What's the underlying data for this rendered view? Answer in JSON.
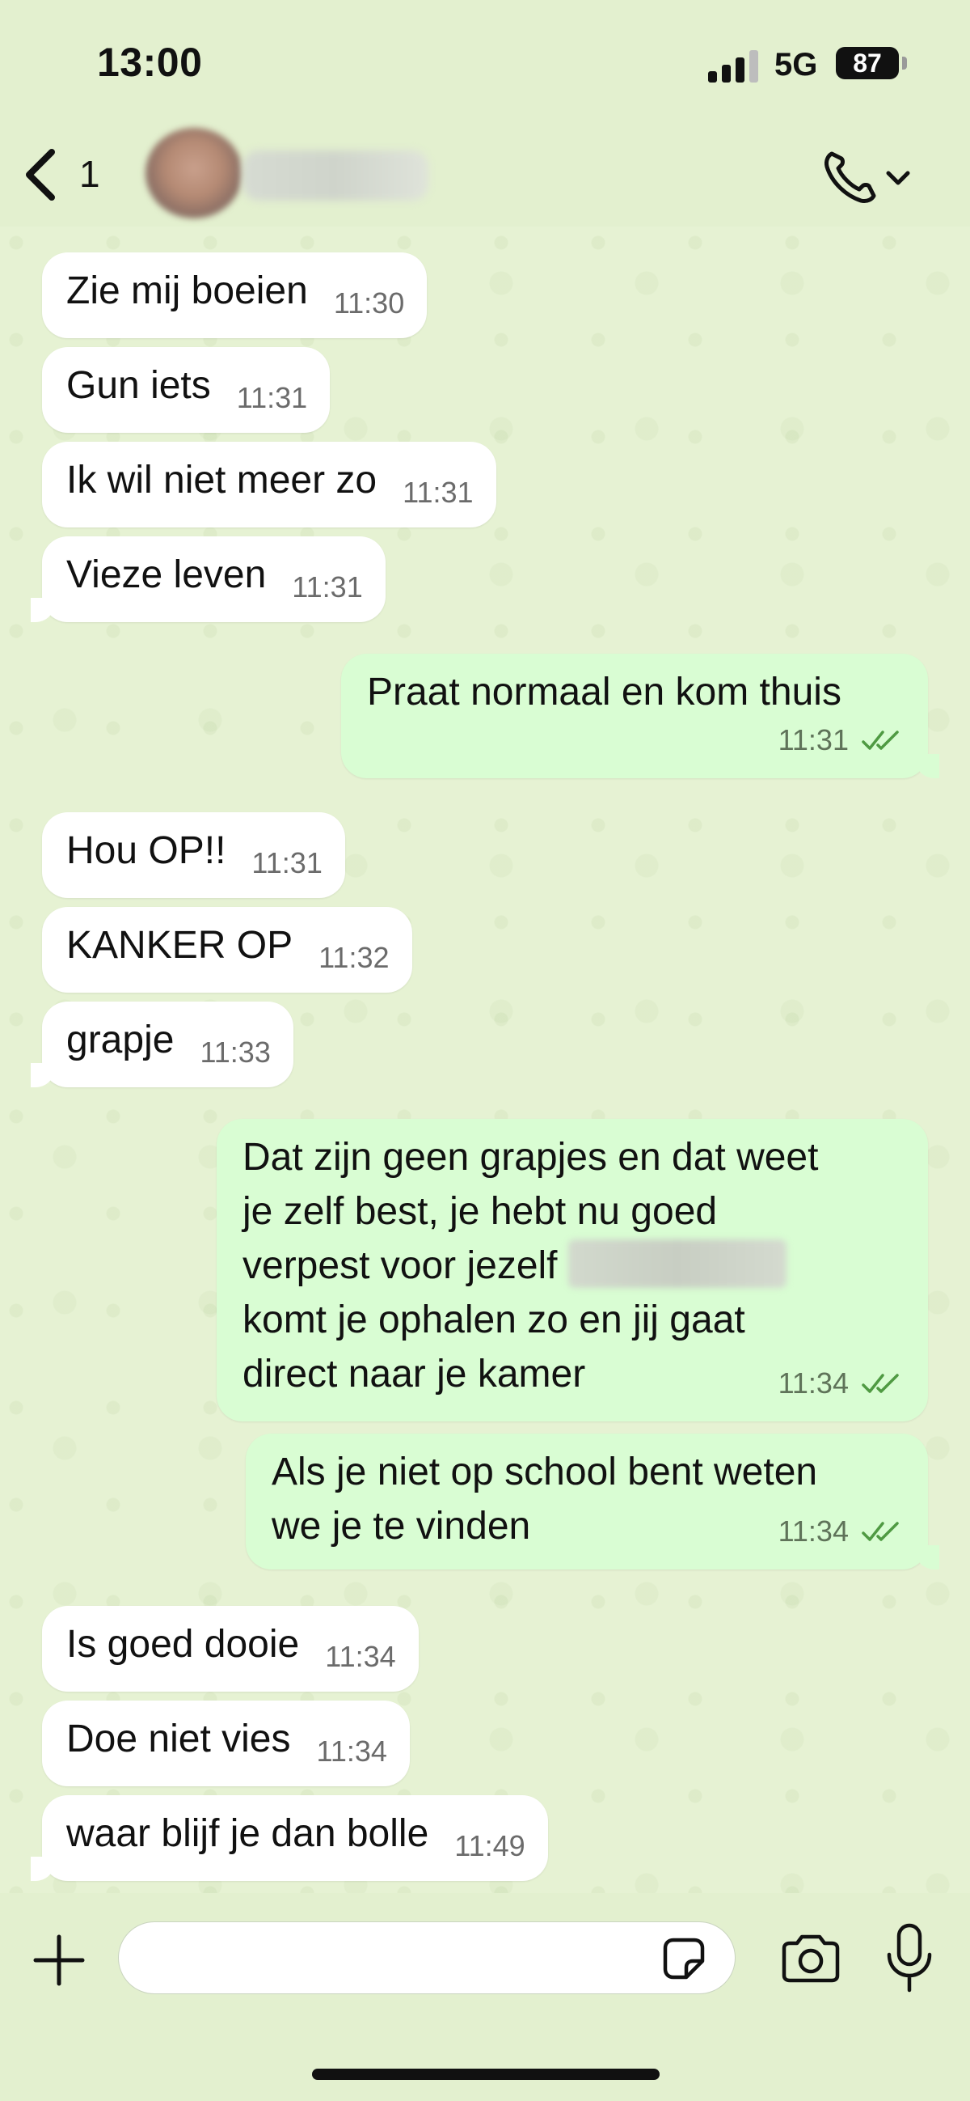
{
  "status_bar": {
    "time": "13:00",
    "network": "5G",
    "battery": "87",
    "signal_bars_active": 3,
    "signal_bars_total": 4
  },
  "header": {
    "back_count": "1",
    "back_icon": "chevron-left-icon",
    "call_icon": "phone-icon",
    "call_dropdown_icon": "chevron-down-icon"
  },
  "messages": [
    {
      "dir": "in",
      "text": "Zie mij boeien",
      "time": "11:30"
    },
    {
      "dir": "in",
      "text": "Gun iets",
      "time": "11:31"
    },
    {
      "dir": "in",
      "text": "Ik wil niet meer zo",
      "time": "11:31"
    },
    {
      "dir": "in",
      "text": "Vieze leven",
      "time": "11:31"
    },
    {
      "dir": "out",
      "text": "Praat normaal en kom thuis",
      "time": "11:31",
      "status": "read"
    },
    {
      "dir": "in",
      "text": "Hou OP!!",
      "time": "11:31"
    },
    {
      "dir": "in",
      "text": "KANKER OP",
      "time": "11:32"
    },
    {
      "dir": "in",
      "text": "grapje",
      "time": "11:33"
    },
    {
      "dir": "out",
      "line1": "Dat zijn geen grapjes en dat weet",
      "line2": "je zelf best, je hebt nu goed",
      "line3_start": "verpest voor jezelf",
      "line4": "komt je ophalen zo en jij gaat",
      "line5": "direct naar je kamer",
      "time": "11:34",
      "status": "read"
    },
    {
      "dir": "out",
      "line1": "Als je niet op school bent weten",
      "line2": "we je te vinden",
      "time": "11:34",
      "status": "read"
    },
    {
      "dir": "in",
      "text": "Is goed dooie",
      "time": "11:34"
    },
    {
      "dir": "in",
      "text": "Doe niet vies",
      "time": "11:34"
    },
    {
      "dir": "in",
      "text": "waar blijf je dan bolle",
      "time": "11:49"
    }
  ],
  "composer": {
    "placeholder": "",
    "value": "",
    "icons": [
      "plus-icon",
      "sticker-icon",
      "camera-icon",
      "microphone-icon"
    ]
  },
  "colors": {
    "chat_background": "#e6f2d3",
    "incoming_bubble": "#ffffff",
    "outgoing_bubble": "#d9fdd3",
    "read_ticks": "#53bdeb"
  }
}
